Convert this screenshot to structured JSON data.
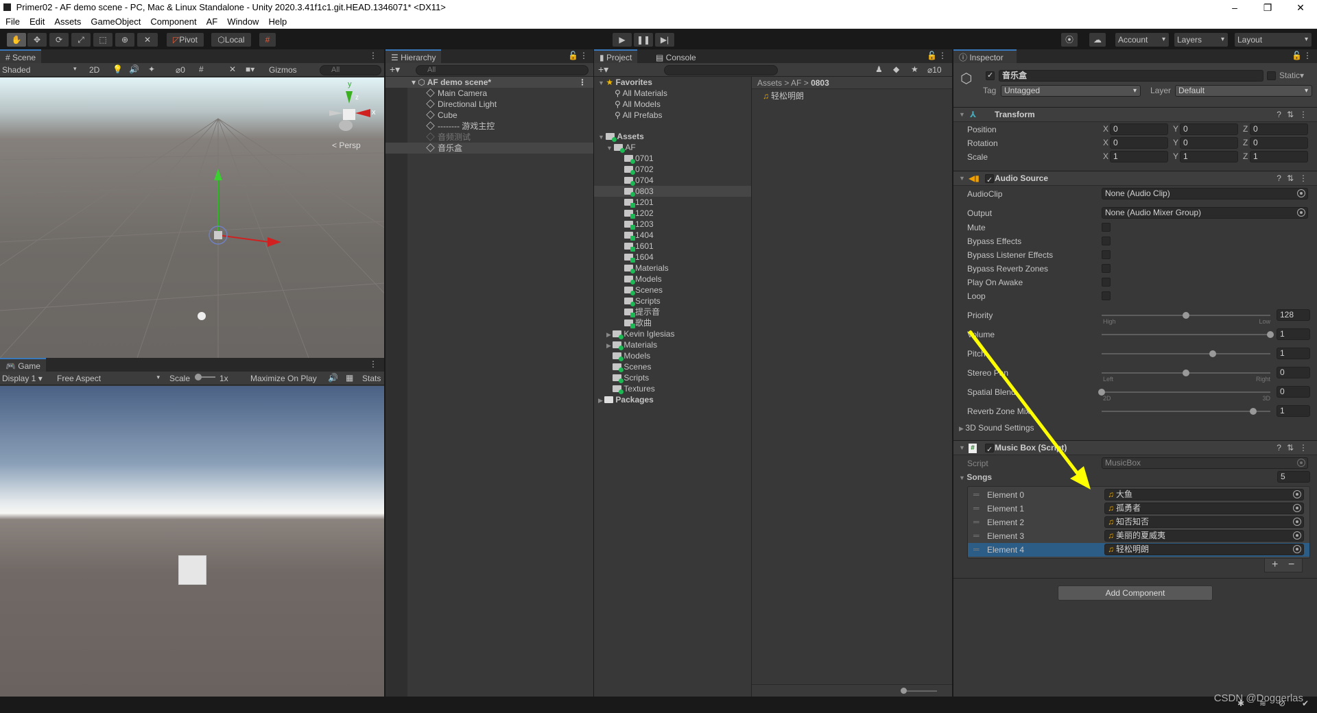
{
  "window": {
    "title": "Primer02 - AF demo scene - PC, Mac & Linux Standalone - Unity 2020.3.41f1c1.git.HEAD.1346071* <DX11>",
    "minimize": "–",
    "restore": "❐",
    "close": "✕"
  },
  "menu": [
    "File",
    "Edit",
    "Assets",
    "GameObject",
    "Component",
    "AF",
    "Window",
    "Help"
  ],
  "toolbar": {
    "pivot": "Pivot",
    "local": "Local",
    "account": "Account",
    "layers": "Layers",
    "layout": "Layout"
  },
  "scene": {
    "tab": "Scene",
    "shading": "Shaded",
    "mode2d": "2D",
    "hidden_count": "0",
    "gizmos": "Gizmos",
    "search_placeholder": "All",
    "persp": "< Persp",
    "axis_x": "x",
    "axis_y": "y",
    "axis_z": "z"
  },
  "game": {
    "tab": "Game",
    "display": "Display 1",
    "aspect": "Free Aspect",
    "scale_label": "Scale",
    "scale_value": "1x",
    "maximize": "Maximize On Play",
    "stats": "Stats"
  },
  "hierarchy": {
    "tab": "Hierarchy",
    "search_placeholder": "All",
    "scene_name": "AF demo scene*",
    "items": [
      {
        "label": "Main Camera",
        "state": "normal"
      },
      {
        "label": "Directional Light",
        "state": "normal"
      },
      {
        "label": "Cube",
        "state": "normal"
      },
      {
        "label": "-------- 游戏主控",
        "state": "normal"
      },
      {
        "label": "音频测试",
        "state": "disabled"
      },
      {
        "label": "音乐盒",
        "state": "selected"
      }
    ]
  },
  "project": {
    "tab": "Project",
    "console_tab": "Console",
    "hidden_count": "10",
    "favorites": {
      "label": "Favorites",
      "items": [
        "All Materials",
        "All Models",
        "All Prefabs"
      ]
    },
    "assets_label": "Assets",
    "af_label": "AF",
    "af_children": [
      {
        "label": "0701",
        "badge": "added"
      },
      {
        "label": "0702",
        "badge": "added"
      },
      {
        "label": "0704",
        "badge": "added"
      },
      {
        "label": "0803",
        "badge": "added",
        "selected": true
      },
      {
        "label": "1201",
        "badge": "modified"
      },
      {
        "label": "1202",
        "badge": "modified"
      },
      {
        "label": "1203",
        "badge": "modified"
      },
      {
        "label": "1404",
        "badge": "modified"
      },
      {
        "label": "1601",
        "badge": "modified"
      },
      {
        "label": "1604",
        "badge": "modified"
      },
      {
        "label": "Materials",
        "badge": "added"
      },
      {
        "label": "Models",
        "badge": "added"
      },
      {
        "label": "Scenes",
        "badge": "added"
      },
      {
        "label": "Scripts",
        "badge": "added"
      },
      {
        "label": "提示音",
        "badge": "modified"
      },
      {
        "label": "歌曲",
        "badge": "modified"
      }
    ],
    "assets_children": [
      {
        "label": "Kevin Iglesias",
        "expandable": true
      },
      {
        "label": "Materials",
        "expandable": true
      },
      {
        "label": "Models"
      },
      {
        "label": "Scenes"
      },
      {
        "label": "Scripts"
      },
      {
        "label": "Textures"
      }
    ],
    "packages_label": "Packages",
    "breadcrumb": [
      "Assets",
      "AF",
      "0803"
    ],
    "files": [
      "轻松明朗"
    ]
  },
  "inspector": {
    "tab": "Inspector",
    "object_name": "音乐盒",
    "static_label": "Static",
    "tag_label": "Tag",
    "tag_value": "Untagged",
    "layer_label": "Layer",
    "layer_value": "Default",
    "transform": {
      "title": "Transform",
      "rows": [
        {
          "label": "Position",
          "x": "0",
          "y": "0",
          "z": "0"
        },
        {
          "label": "Rotation",
          "x": "0",
          "y": "0",
          "z": "0"
        },
        {
          "label": "Scale",
          "x": "1",
          "y": "1",
          "z": "1"
        }
      ]
    },
    "audio_source": {
      "title": "Audio Source",
      "audioclip_label": "AudioClip",
      "audioclip_value": "None (Audio Clip)",
      "output_label": "Output",
      "output_value": "None (Audio Mixer Group)",
      "toggles": [
        {
          "label": "Mute",
          "checked": false
        },
        {
          "label": "Bypass Effects",
          "checked": false
        },
        {
          "label": "Bypass Listener Effects",
          "checked": false
        },
        {
          "label": "Bypass Reverb Zones",
          "checked": false
        },
        {
          "label": "Play On Awake",
          "checked": false
        },
        {
          "label": "Loop",
          "checked": false
        }
      ],
      "sliders": [
        {
          "label": "Priority",
          "value": "128",
          "fraction": 0.5,
          "min_label": "High",
          "max_label": "Low"
        },
        {
          "label": "Volume",
          "value": "1",
          "fraction": 1.0
        },
        {
          "label": "Pitch",
          "value": "1",
          "fraction": 0.66
        },
        {
          "label": "Stereo Pan",
          "value": "0",
          "fraction": 0.5,
          "min_label": "Left",
          "max_label": "Right"
        },
        {
          "label": "Spatial Blend",
          "value": "0",
          "fraction": 0.0,
          "min_label": "2D",
          "max_label": "3D"
        },
        {
          "label": "Reverb Zone Mix",
          "value": "1",
          "fraction": 0.9
        }
      ],
      "sound3d_label": "3D Sound Settings"
    },
    "music_box": {
      "title": "Music Box (Script)",
      "script_label": "Script",
      "script_value": "MusicBox",
      "songs_label": "Songs",
      "songs_count": "5",
      "elements": [
        {
          "label": "Element 0",
          "value": "大鱼"
        },
        {
          "label": "Element 1",
          "value": "孤勇者"
        },
        {
          "label": "Element 2",
          "value": "知否知否"
        },
        {
          "label": "Element 3",
          "value": "美丽的夏威夷"
        },
        {
          "label": "Element 4",
          "value": "轻松明朗",
          "selected": true
        }
      ],
      "add": "+",
      "remove": "−"
    },
    "add_component": "Add Component"
  },
  "watermark": "CSDN @Doggerlas",
  "colors": {
    "accent": "#3a79bb",
    "selection": "#2c5d87",
    "annotation_arrow": "#ffff00",
    "vcs_badge": "#1db954"
  }
}
